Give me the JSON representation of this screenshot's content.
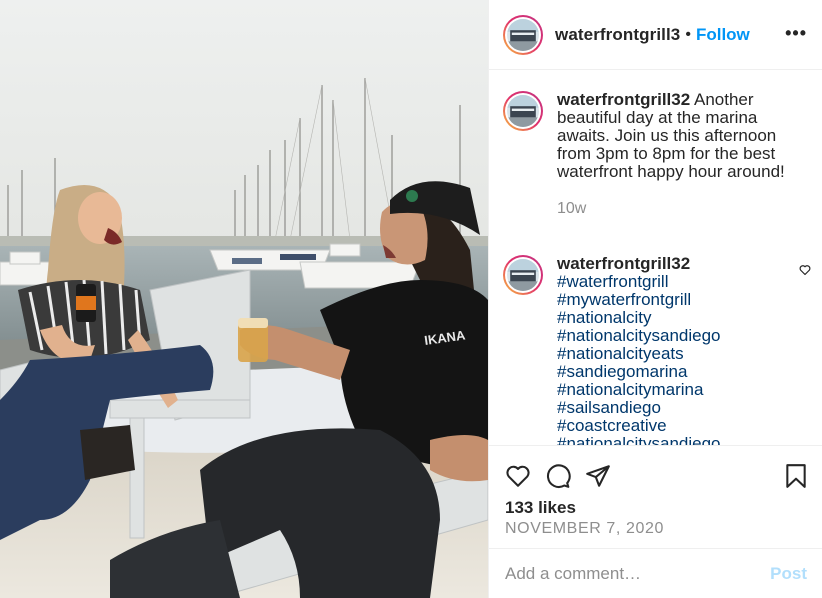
{
  "post": {
    "image_alt_icon": "photo-marina-happy-hour",
    "header": {
      "username": "waterfrontgrill3",
      "separator": "•",
      "follow_label": "Follow",
      "more_icon": "more-horizontal-icon"
    },
    "caption": {
      "username": "waterfrontgrill32",
      "text": "Another beautiful day at the marina awaits. Join us this afternoon from 3pm to 8pm for the best waterfront happy hour around!",
      "time": "10w"
    },
    "hashtag_comment": {
      "username": "waterfrontgrill32",
      "tags": [
        "#waterfrontgrill",
        "#mywaterfrontgrill",
        "#nationalcity",
        "#nationalcitysandiego",
        "#nationalcityeats",
        "#sandiegomarina",
        "#nationalcitymarina",
        "#sailsandiego",
        "#coastcreative",
        "#nationalcitysandiego"
      ]
    },
    "actions": {
      "like_icon": "heart-icon",
      "comment_icon": "comment-icon",
      "share_icon": "share-icon",
      "save_icon": "bookmark-icon"
    },
    "likes": "133 likes",
    "date": "NOVEMBER 7, 2020",
    "add_comment": {
      "placeholder": "Add a comment…",
      "post_label": "Post"
    },
    "colors": {
      "accent": "#0095f6",
      "hashtag": "#00376b",
      "muted": "#8e8e8e",
      "post_disabled": "#b2dffc"
    }
  }
}
